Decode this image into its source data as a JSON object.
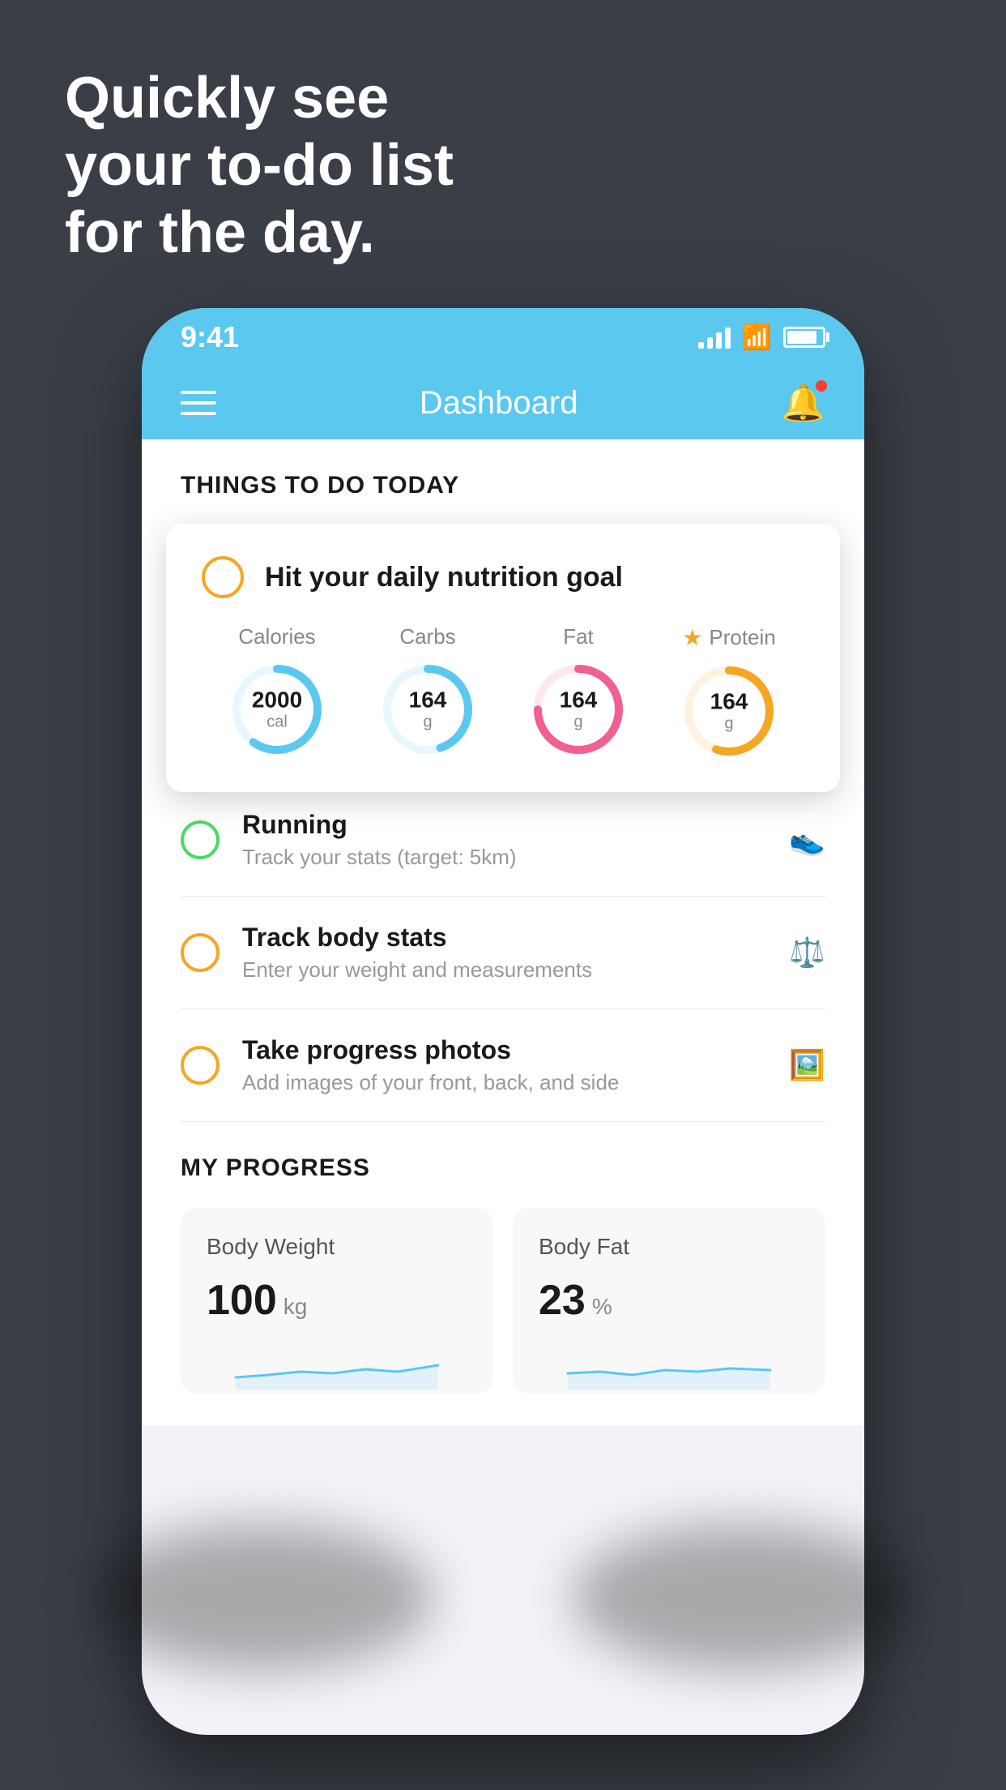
{
  "hero": {
    "line1": "Quickly see",
    "line2": "your to-do list",
    "line3": "for the day."
  },
  "statusBar": {
    "time": "9:41",
    "signalBars": [
      8,
      14,
      20,
      26
    ],
    "batteryPercent": 85
  },
  "navBar": {
    "title": "Dashboard",
    "hamburgerLabel": "menu",
    "bellLabel": "notifications"
  },
  "thingsToDo": {
    "sectionTitle": "THINGS TO DO TODAY",
    "nutritionCard": {
      "title": "Hit your daily nutrition goal",
      "stats": [
        {
          "label": "Calories",
          "value": "2000",
          "unit": "cal",
          "color": "#5bc8f0",
          "progress": 0.6,
          "starred": false
        },
        {
          "label": "Carbs",
          "value": "164",
          "unit": "g",
          "color": "#5bc8f0",
          "progress": 0.45,
          "starred": false
        },
        {
          "label": "Fat",
          "value": "164",
          "unit": "g",
          "color": "#f06090",
          "progress": 0.75,
          "starred": false
        },
        {
          "label": "Protein",
          "value": "164",
          "unit": "g",
          "color": "#f5a623",
          "progress": 0.55,
          "starred": true
        }
      ]
    },
    "items": [
      {
        "name": "Running",
        "desc": "Track your stats (target: 5km)",
        "circleColor": "green",
        "icon": "👟"
      },
      {
        "name": "Track body stats",
        "desc": "Enter your weight and measurements",
        "circleColor": "yellow",
        "icon": "⚖️"
      },
      {
        "name": "Take progress photos",
        "desc": "Add images of your front, back, and side",
        "circleColor": "yellow2",
        "icon": "🖼️"
      }
    ]
  },
  "myProgress": {
    "sectionTitle": "MY PROGRESS",
    "cards": [
      {
        "title": "Body Weight",
        "value": "100",
        "unit": "kg"
      },
      {
        "title": "Body Fat",
        "value": "23",
        "unit": "%"
      }
    ]
  },
  "colors": {
    "appBlue": "#5bc8f0",
    "bgDark": "#3a3f47",
    "yellow": "#f5a623",
    "green": "#4cd964",
    "pink": "#f06090"
  }
}
